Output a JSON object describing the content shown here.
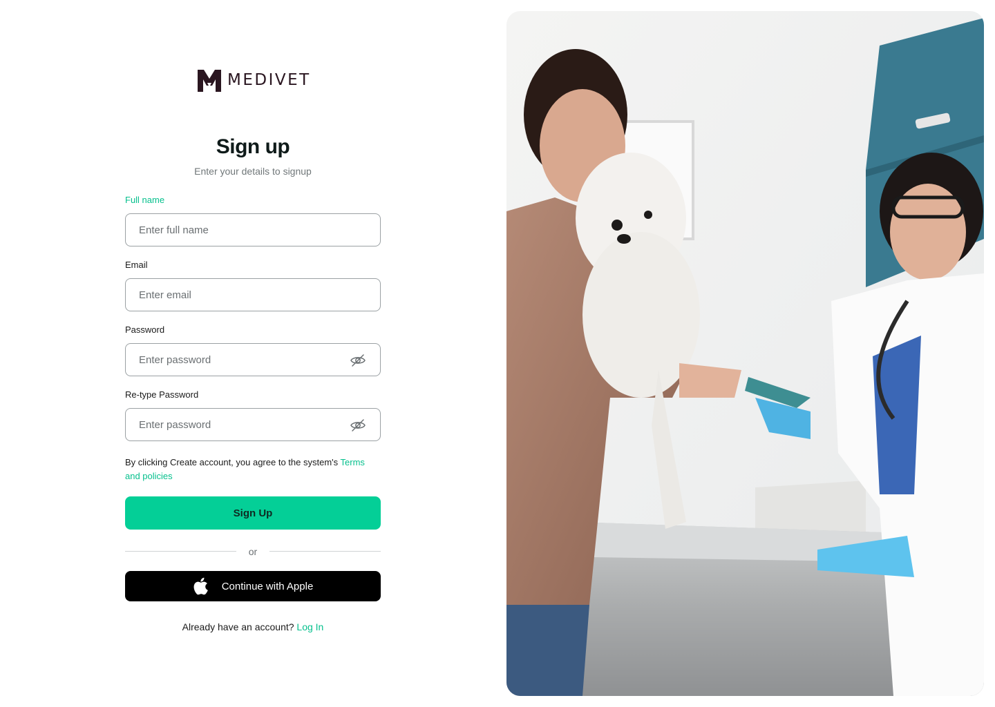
{
  "brand": {
    "name": "MEDIVET"
  },
  "header": {
    "title": "Sign up",
    "subtitle": "Enter your details to signup"
  },
  "form": {
    "full_name": {
      "label": "Full name",
      "placeholder": "Enter full name"
    },
    "email": {
      "label": "Email",
      "placeholder": "Enter email"
    },
    "password": {
      "label": "Password",
      "placeholder": "Enter password"
    },
    "retype_password": {
      "label": "Re-type Password",
      "placeholder": "Enter password"
    },
    "terms_text": "By clicking Create account, you agree to the system's ",
    "terms_link": "Terms and policies",
    "submit_label": "Sign Up",
    "divider_label": "or",
    "apple_label": "Continue with Apple",
    "login_prompt": "Already have an account? ",
    "login_link": "Log In"
  },
  "icons": {
    "logo": "medivet-logo-icon",
    "eye_hidden": "eye-off-icon",
    "apple": "apple-icon"
  },
  "colors": {
    "accent": "#04cf97",
    "accent_text": "#06c08d",
    "dark": "#000000",
    "brand_dark": "#2a1620"
  }
}
